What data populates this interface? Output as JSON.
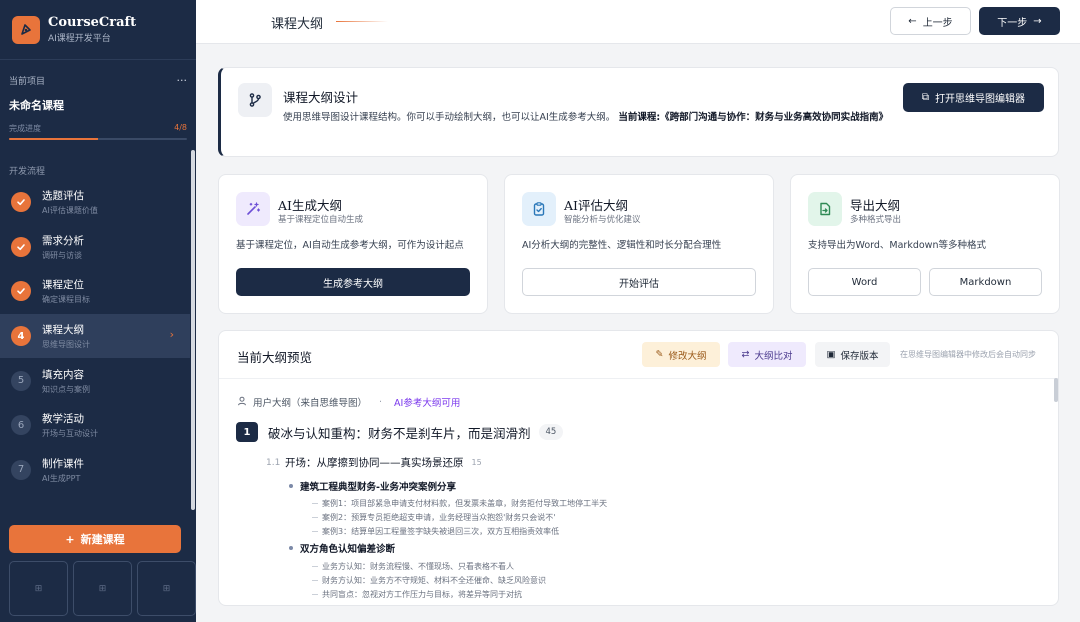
{
  "brand": {
    "name": "CourseCraft",
    "sub": "AI课程开发平台"
  },
  "project": {
    "label": "当前项目",
    "menu": "···",
    "name": "未命名课程",
    "progress_label": "完成进度",
    "progress_value": "4/8",
    "progress_fraction": 0.5
  },
  "steps_label": "开发流程",
  "steps": [
    {
      "num": "✓",
      "title": "选题评估",
      "sub": "AI评估课题价值",
      "state": "done"
    },
    {
      "num": "✓",
      "title": "需求分析",
      "sub": "调研与访谈",
      "state": "done"
    },
    {
      "num": "✓",
      "title": "课程定位",
      "sub": "确定课程目标",
      "state": "done"
    },
    {
      "num": "4",
      "title": "课程大纲",
      "sub": "思维导图设计",
      "state": "active"
    },
    {
      "num": "5",
      "title": "填充内容",
      "sub": "知识点与案例",
      "state": "todo"
    },
    {
      "num": "6",
      "title": "教学活动",
      "sub": "开场与互动设计",
      "state": "todo"
    },
    {
      "num": "7",
      "title": "制作课件",
      "sub": "AI生成PPT",
      "state": "todo"
    }
  ],
  "new_course": "新建课程",
  "header": {
    "title": "课程大纲",
    "prev": "上一步",
    "next": "下一步"
  },
  "design": {
    "title": "课程大纲设计",
    "desc": "使用思维导图设计课程结构。你可以手动绘制大纲，也可以让AI生成参考大纲。",
    "current_label": "当前课程:《跨部门沟通与协作：财务与业务高效协同实战指南》",
    "button": "打开思维导图编辑器"
  },
  "cards": {
    "ai_gen": {
      "title": "AI生成大纲",
      "sub": "基于课程定位自动生成",
      "desc": "基于课程定位，AI自动生成参考大纲，可作为设计起点",
      "button": "生成参考大纲"
    },
    "ai_eval": {
      "title": "AI评估大纲",
      "sub": "智能分析与优化建议",
      "desc": "AI分析大纲的完整性、逻辑性和时长分配合理性",
      "button": "开始评估"
    },
    "export": {
      "title": "导出大纲",
      "sub": "多种格式导出",
      "desc": "支持导出为Word、Markdown等多种格式",
      "button_word": "Word",
      "button_md": "Markdown"
    }
  },
  "preview": {
    "title": "当前大纲预览",
    "edit": "修改大纲",
    "compare": "大纲比对",
    "save": "保存版本",
    "autosave": "在思维导图编辑器中修改后会自动同步",
    "source": "用户大纲（来自思维导图）",
    "source_sep": "·",
    "source_ref": "AI参考大纲可用",
    "chapter": {
      "num": "1",
      "title": "破冰与认知重构：财务不是刹车片，而是润滑剂",
      "count": "45"
    },
    "section": {
      "num": "1.1",
      "title": "开场：从摩擦到协同——真实场景还原",
      "count": "15"
    },
    "topics": [
      {
        "title": "建筑工程典型财务-业务冲突案例分享",
        "items": [
          "案例1：项目部紧急申请支付材料款，但发票未盖章，财务拒付导致工地停工半天",
          "案例2：预算专员拒绝超支申请，业务经理当众抱怨'财务只会说不'",
          "案例3：结算单因工程量签字缺失被退回三次，双方互相指责效率低"
        ]
      },
      {
        "title": "双方角色认知偏差诊断",
        "items": [
          "业务方认知：财务流程慢、不懂现场、只看表格不看人",
          "财务方认知：业务方不守规矩、材料不全还催命、缺乏风险意识",
          "共同盲点：忽视对方工作压力与目标，将差异等同于对抗"
        ]
      }
    ]
  }
}
